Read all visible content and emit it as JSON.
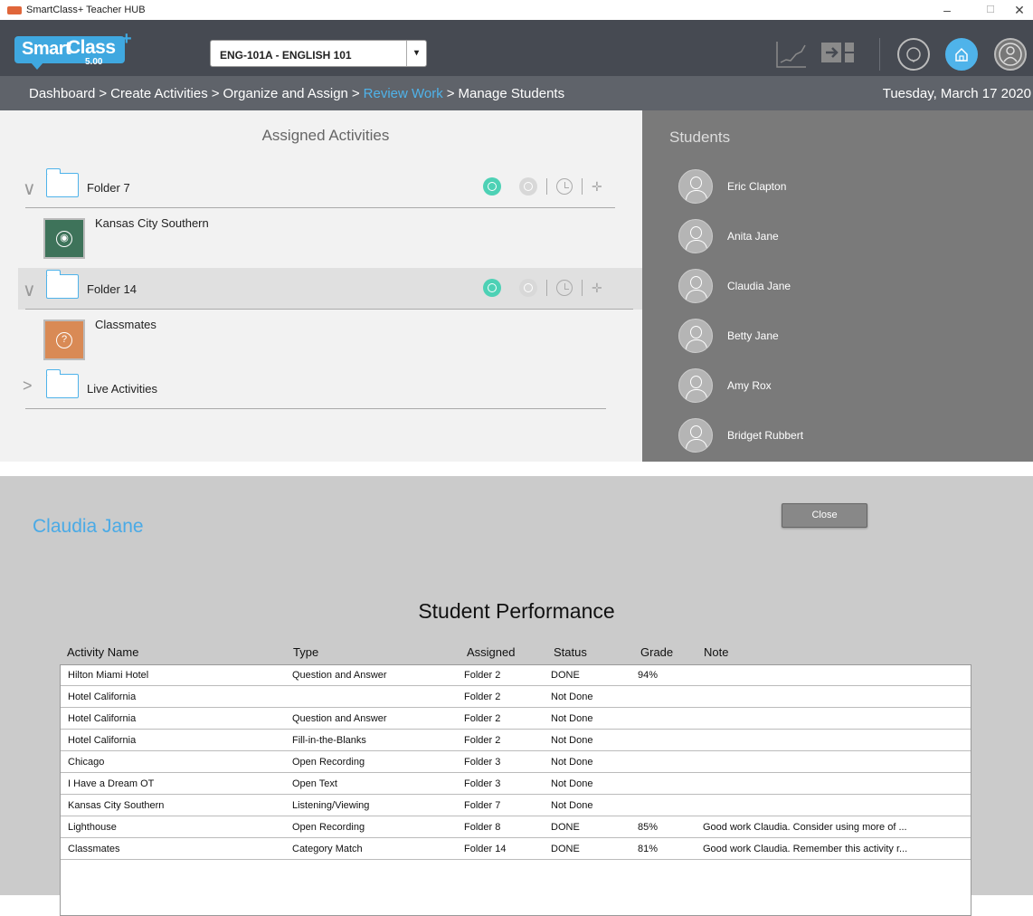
{
  "window": {
    "title": "SmartClass+ Teacher HUB",
    "minimize": "–",
    "maximize": "☐",
    "close": "✕"
  },
  "logo": {
    "word1": "Smart",
    "word2": "Class",
    "plus": "+",
    "version": "5.00"
  },
  "course_select": {
    "value": "ENG-101A - ENGLISH 101",
    "caret": "▾"
  },
  "breadcrumb": {
    "items": [
      "Dashboard",
      "Create Activities",
      "Organize and Assign",
      "Review Work",
      "Manage Students"
    ],
    "separator": ">",
    "active_index": 3,
    "date": "Tuesday, March 17 2020"
  },
  "assigned": {
    "title": "Assigned Activities",
    "folders": [
      {
        "name": "Folder 7",
        "expanded": true,
        "chevron": "∨",
        "activities": [
          {
            "name": "Kansas City Southern",
            "color": "#3e735a",
            "icon": "eye-icon",
            "symbol": "◉"
          }
        ]
      },
      {
        "name": "Folder 14",
        "expanded": true,
        "chevron": "∨",
        "activities": [
          {
            "name": "Classmates",
            "color": "#d98a55",
            "icon": "question-icon",
            "symbol": "?"
          }
        ]
      },
      {
        "name": "Live Activities",
        "expanded": false,
        "chevron": ">",
        "activities": []
      }
    ]
  },
  "students": {
    "title": "Students",
    "list": [
      "Eric Clapton",
      "Anita Jane",
      "Claudia Jane",
      "Betty Jane",
      "Amy Rox",
      "Bridget Rubbert"
    ]
  },
  "modal": {
    "student_name": "Claudia Jane",
    "close_label": "Close",
    "title": "Student Performance",
    "columns": [
      "Activity Name",
      "Type",
      "Assigned",
      "Status",
      "Grade",
      "Note"
    ],
    "rows": [
      [
        "Hilton Miami Hotel",
        "Question and Answer",
        "Folder 2",
        "DONE",
        "94%",
        ""
      ],
      [
        "Hotel California",
        "",
        "Folder 2",
        "Not Done",
        "",
        ""
      ],
      [
        "Hotel California",
        "Question and Answer",
        "Folder 2",
        "Not Done",
        "",
        ""
      ],
      [
        "Hotel California",
        "Fill-in-the-Blanks",
        "Folder 2",
        "Not Done",
        "",
        ""
      ],
      [
        "Chicago",
        "Open Recording",
        "Folder 3",
        "Not Done",
        "",
        ""
      ],
      [
        "I Have a Dream OT",
        "Open Text",
        "Folder 3",
        "Not Done",
        "",
        ""
      ],
      [
        "Kansas City Southern",
        "Listening/Viewing",
        "Folder 7",
        "Not Done",
        "",
        ""
      ],
      [
        "Lighthouse",
        "Open Recording",
        "Folder 8",
        "DONE",
        "85%",
        "Good work Claudia.  Consider using more of ..."
      ],
      [
        "Classmates",
        "Category Match",
        "Folder 14",
        "DONE",
        "81%",
        "Good work Claudia.  Remember this activity r..."
      ]
    ]
  },
  "colors": {
    "accent": "#4fb3ea",
    "header_bg": "#464a52",
    "breadcrumb_bg": "#5f636a",
    "right_pane": "#7a7a7a"
  }
}
